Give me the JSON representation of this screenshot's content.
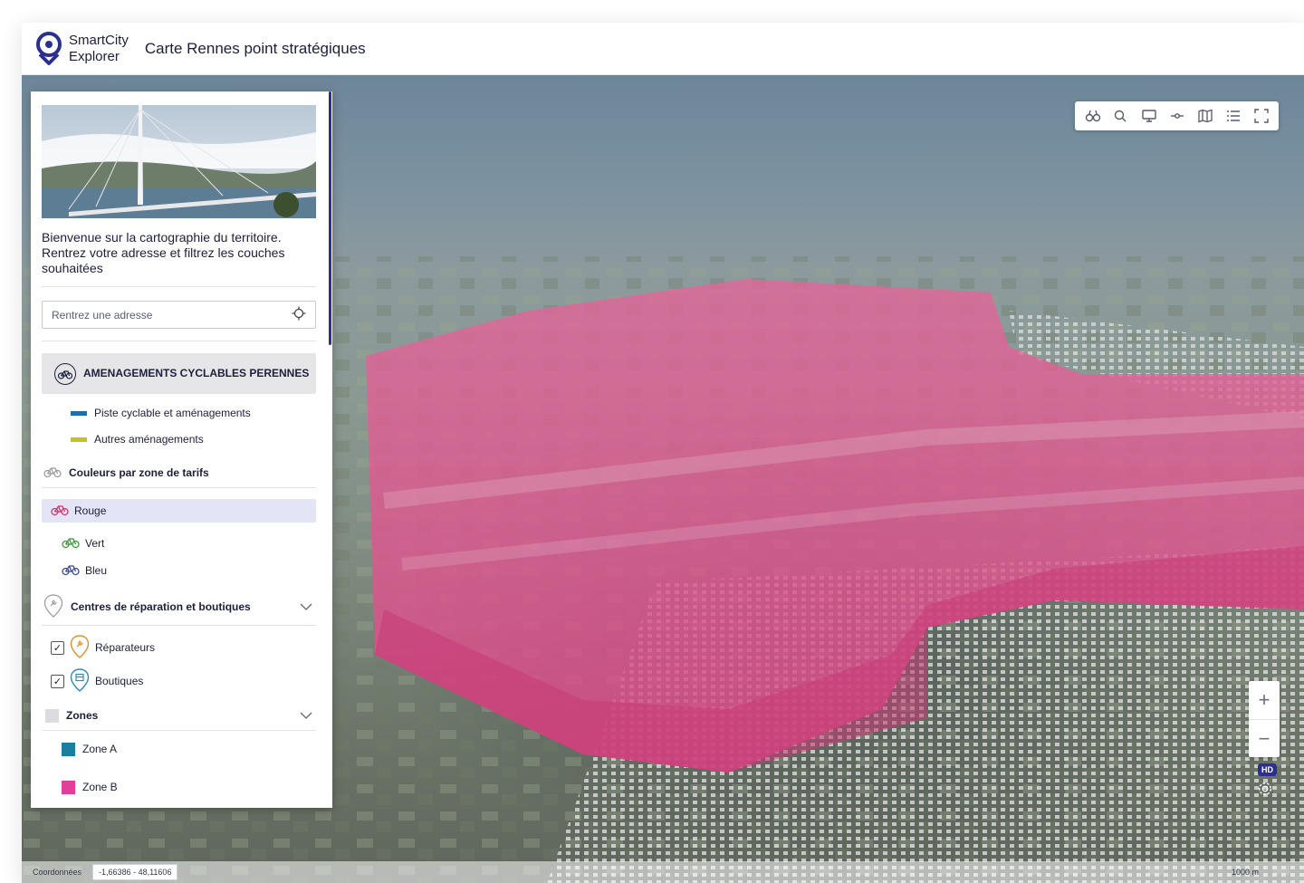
{
  "app": {
    "brand_line1": "SmartCity",
    "brand_line2": "Explorer",
    "title": "Carte Rennes point stratégiques"
  },
  "panel": {
    "welcome_text": "Bienvenue sur la cartographie du territoire. Rentrez votre adresse et filtrez les couches souhaitées",
    "search": {
      "placeholder": "Rentrez une adresse"
    },
    "group_cycle": {
      "label": "AMENAGEMENTS CYCLABLES PERENNES",
      "items": [
        {
          "label": "Piste cyclable et aménagements",
          "color": "#1e6fa8"
        },
        {
          "label": "Autres aménagements",
          "color": "#c4c41f"
        }
      ]
    },
    "tarif_zone": {
      "label": "Couleurs par zone de tarifs",
      "items": [
        {
          "label": "Rouge",
          "color": "#d6336c",
          "selected": true
        },
        {
          "label": "Vert",
          "color": "#3a9a3a"
        },
        {
          "label": "Bleu",
          "color": "#3b4b9a"
        }
      ]
    },
    "repair": {
      "label": "Centres de réparation et boutiques",
      "items": [
        {
          "label": "Réparateurs",
          "checked": true,
          "color": "#e2922b"
        },
        {
          "label": "Boutiques",
          "checked": true,
          "color": "#2f8bbf"
        }
      ]
    },
    "zones": {
      "label": "Zones",
      "items": [
        {
          "label": "Zone A",
          "color": "#1a7fa0"
        },
        {
          "label": "Zone B",
          "color": "#e0409a"
        }
      ]
    }
  },
  "map": {
    "hd_label": "HD",
    "zoom_in": "+",
    "zoom_out": "−",
    "status": {
      "coord_label": "Coordonnées",
      "coord_value": "-1,66386 - 48,11606",
      "scale": "1000 m"
    },
    "toolbar_icons": [
      "binoculars-icon",
      "search-icon",
      "screen-icon",
      "line-measure-icon",
      "map-icon",
      "list-icon",
      "fullscreen-icon"
    ],
    "zone_color": "#e4669a"
  }
}
